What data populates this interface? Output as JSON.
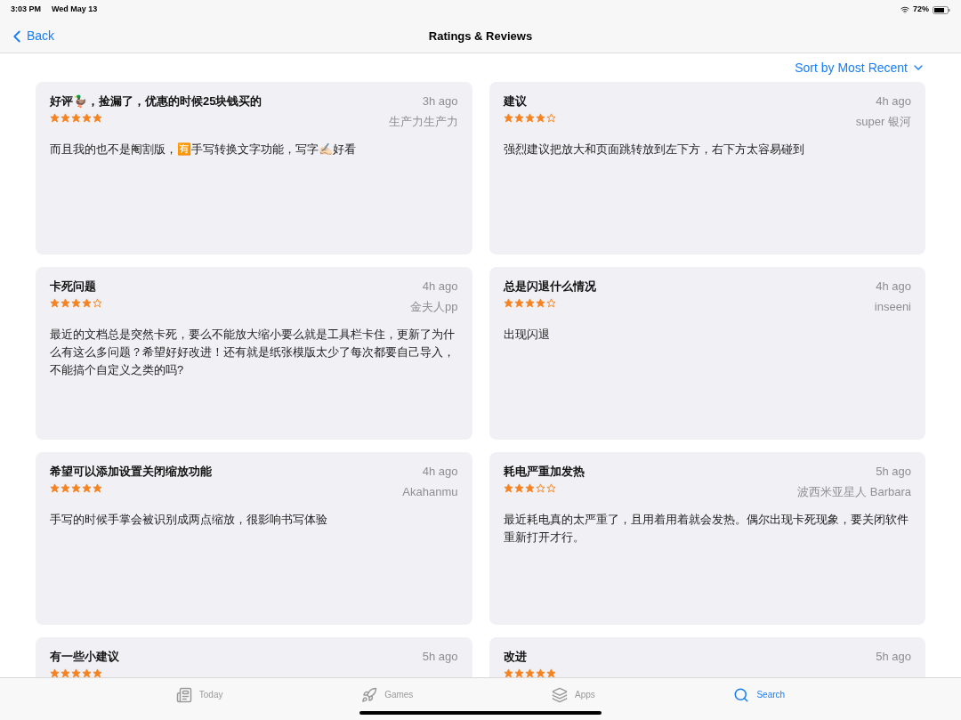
{
  "status_bar": {
    "time": "3:03 PM",
    "date": "Wed May 13",
    "battery": "72%"
  },
  "nav": {
    "back": "Back",
    "title": "Ratings & Reviews"
  },
  "sort": {
    "label": "Sort by Most Recent"
  },
  "reviews": [
    {
      "title": "好评🦆，捡漏了，优惠的时候25块钱买的",
      "time": "3h ago",
      "stars": 5,
      "author": "生产力生产力",
      "body": "而且我的也不是阉割版，🈶手写转换文字功能，写字✍🏻好看"
    },
    {
      "title": "建议",
      "time": "4h ago",
      "stars": 4,
      "author": "super 银河",
      "body": "强烈建议把放大和页面跳转放到左下方，右下方太容易碰到"
    },
    {
      "title": "卡死问题",
      "time": "4h ago",
      "stars": 4,
      "author": "金夫人pp",
      "body": "最近的文档总是突然卡死，要么不能放大缩小要么就是工具栏卡住，更新了为什么有这么多问题？希望好好改进！还有就是纸张模版太少了每次都要自己导入，不能搞个自定义之类的吗?"
    },
    {
      "title": "总是闪退什么情况",
      "time": "4h ago",
      "stars": 4,
      "author": "inseeni",
      "body": "出现闪退"
    },
    {
      "title": "希望可以添加设置关闭缩放功能",
      "time": "4h ago",
      "stars": 5,
      "author": "Akahanmu",
      "body": "手写的时候手掌会被识别成两点缩放，很影响书写体验"
    },
    {
      "title": "耗电严重加发热",
      "time": "5h ago",
      "stars": 3,
      "author": "波西米亚星人 Barbara",
      "body": "最近耗电真的太严重了，且用着用着就会发热。偶尔出现卡死现象，要关闭软件重新打开才行。"
    },
    {
      "title": "有一些小建议",
      "time": "5h ago",
      "stars": 5
    },
    {
      "title": "改进",
      "time": "5h ago",
      "stars": 5
    }
  ],
  "tabs": [
    {
      "kind": "today",
      "label": "Today",
      "selected": false
    },
    {
      "kind": "games",
      "label": "Games",
      "selected": false
    },
    {
      "kind": "apps",
      "label": "Apps",
      "selected": false
    },
    {
      "kind": "search",
      "label": "Search",
      "selected": true
    }
  ]
}
